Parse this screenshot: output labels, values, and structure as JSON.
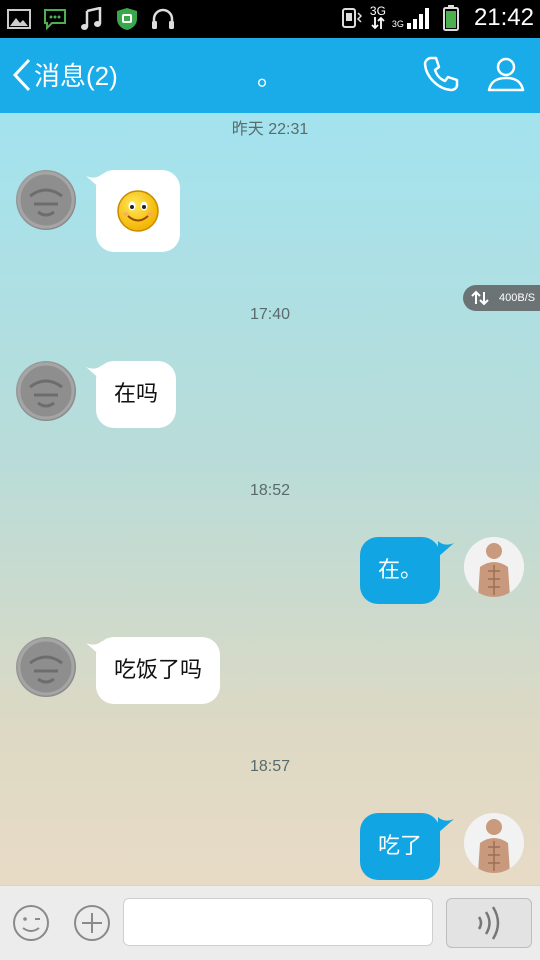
{
  "status_bar": {
    "network_type": "3G",
    "network_type_small": "3G",
    "time": "21:42",
    "icons": [
      "image-icon",
      "chat-icon",
      "music-icon",
      "shield-icon",
      "headphones-icon",
      "vibrate-icon",
      "signal-icon",
      "battery-icon"
    ]
  },
  "header": {
    "back_label": "消息(2)",
    "title": "。",
    "icons": [
      "phone-icon",
      "profile-icon"
    ]
  },
  "net_speed": "400B/S",
  "chat": {
    "timestamps": [
      "昨天 22:31",
      "17:40",
      "18:52",
      "18:57"
    ],
    "messages": [
      {
        "side": "in",
        "type": "emoji",
        "emoji": "smiley-emoji"
      },
      {
        "side": "in",
        "text": "在吗"
      },
      {
        "side": "out",
        "text": "在。"
      },
      {
        "side": "in",
        "text": "吃饭了吗"
      },
      {
        "side": "out",
        "text": "吃了"
      }
    ]
  },
  "input_bar": {
    "value": "",
    "placeholder": "",
    "icons": [
      "emoji-icon",
      "plus-icon",
      "voice-icon"
    ]
  },
  "colors": {
    "accent": "#19ace8",
    "outgoing_bubble": "#12a5e3",
    "incoming_bubble": "#ffffff"
  }
}
